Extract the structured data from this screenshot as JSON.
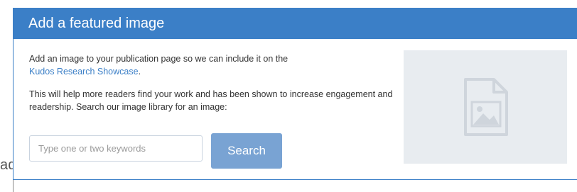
{
  "background": {
    "partial_text": "ador"
  },
  "panel": {
    "title": "Add a featured image",
    "intro_text": "Add an image to your publication page so we can include it on the",
    "intro_link": "Kudos Research Showcase",
    "intro_suffix": ".",
    "description": "This will help more readers find your work and has been shown to increase engagement and readership. Search our image library for an image:",
    "search": {
      "placeholder": "Type one or two keywords",
      "value": "",
      "button_label": "Search"
    },
    "placeholder_icon": "image-file-icon"
  },
  "colors": {
    "header_bg": "#3b7fc7",
    "link": "#3b7fc7",
    "button_bg": "#79a3d3",
    "placeholder_bg": "#e8ecf0"
  }
}
